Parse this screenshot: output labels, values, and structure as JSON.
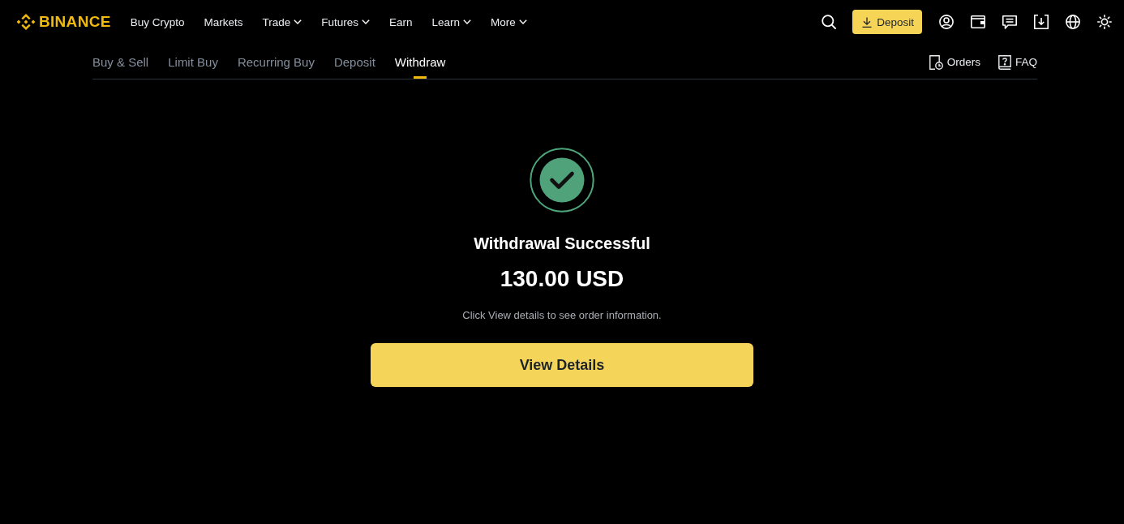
{
  "header": {
    "logo": "BINANCE",
    "nav": [
      {
        "label": "Buy Crypto",
        "dropdown": false
      },
      {
        "label": "Markets",
        "dropdown": false
      },
      {
        "label": "Trade",
        "dropdown": true
      },
      {
        "label": "Futures",
        "dropdown": true
      },
      {
        "label": "Earn",
        "dropdown": false
      },
      {
        "label": "Learn",
        "dropdown": true
      },
      {
        "label": "More",
        "dropdown": true
      }
    ],
    "deposit_button": "Deposit"
  },
  "subnav": {
    "tabs": [
      {
        "label": "Buy & Sell",
        "selected": false
      },
      {
        "label": "Limit Buy",
        "selected": false
      },
      {
        "label": "Recurring Buy",
        "selected": false
      },
      {
        "label": "Deposit",
        "selected": false
      },
      {
        "label": "Withdraw",
        "selected": true
      }
    ],
    "orders_link": "Orders",
    "faq_link": "FAQ"
  },
  "result": {
    "title": "Withdrawal Successful",
    "amount": "130.00 USD",
    "note": "Click View details to see order information.",
    "button": "View Details"
  }
}
